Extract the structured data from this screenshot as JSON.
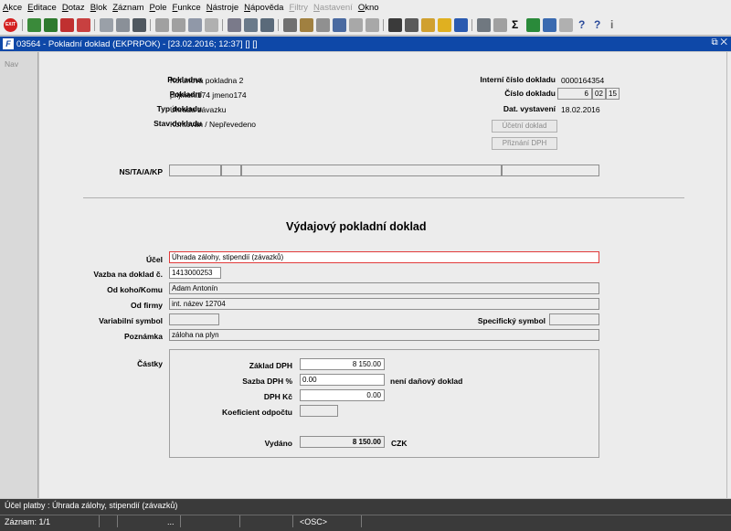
{
  "menu": [
    "Akce",
    "Editace",
    "Dotaz",
    "Blok",
    "Záznam",
    "Pole",
    "Funkce",
    "Nástroje",
    "Nápověda",
    "Filtry",
    "Nastavení",
    "Okno"
  ],
  "menu_disabled": [
    "Filtry",
    "Nastavení"
  ],
  "toolbar": {
    "exit_label": "EXIT",
    "sigma": "Σ",
    "help_q": "?",
    "info_i": "i"
  },
  "window": {
    "title": "03564 - Pokladní doklad (EKPRPOK) - [23.02.2016; 12:37] [] []",
    "buttons": "⧉ ✕"
  },
  "nav": {
    "label": "Nav"
  },
  "form": {
    "pokladna_label": "Pokladna",
    "pokladna_value": "Korunová pokladna 2",
    "pokladni_label": "Pokladní",
    "pokladni_value": "prijmeni174 jmeno174",
    "typ_label": "Typ dokladu",
    "typ_value": "Úhrada závazku",
    "stav_label": "Stav dokladu",
    "stav_value": "Kontován / Nepřevedeno",
    "interni_label": "Interní číslo dokladu",
    "interni_value": "0000164354",
    "cislo_label": "Číslo dokladu",
    "cislo_parts": [
      "6",
      "02",
      "15"
    ],
    "datum_label": "Dat. vystavení",
    "datum_value": "18.02.2016",
    "ucetni_btn": "Účetní doklad",
    "priznani_btn": "Přiznání DPH",
    "ns_label": "NS/TA/A/KP",
    "heading": "Výdajový pokladní doklad",
    "ucel_label": "Účel",
    "ucel_value": "Úhrada zálohy, stipendií  (závazků)",
    "vazba_label": "Vazba na doklad č.",
    "vazba_value": "1413000253",
    "odkoho_label": "Od koho/Komu",
    "odkoho_value": "Adam Antonín",
    "odfirmy_label": "Od firmy",
    "odfirmy_value": "int. název 12704",
    "vs_label": "Variabilní symbol",
    "ss_label": "Specifický symbol",
    "poznamka_label": "Poznámka",
    "poznamka_value": "záloha na plyn",
    "castky_label": "Částky",
    "zaklad_label": "Základ DPH",
    "zaklad_value": "8 150.00",
    "sazba_label": "Sazba DPH %",
    "sazba_value": "0.00",
    "neni_label": "není daňový doklad",
    "dph_label": "DPH Kč",
    "dph_value": "0.00",
    "koef_label": "Koeficient odpočtu",
    "vydano_label": "Vydáno",
    "vydano_value": "8 150.00",
    "currency": "CZK"
  },
  "status": {
    "message": "Účel platby : Úhrada zálohy, stipendií  (závazků)",
    "record": "Záznam: 1/1",
    "dots": "...",
    "osc": "<OSC>"
  }
}
